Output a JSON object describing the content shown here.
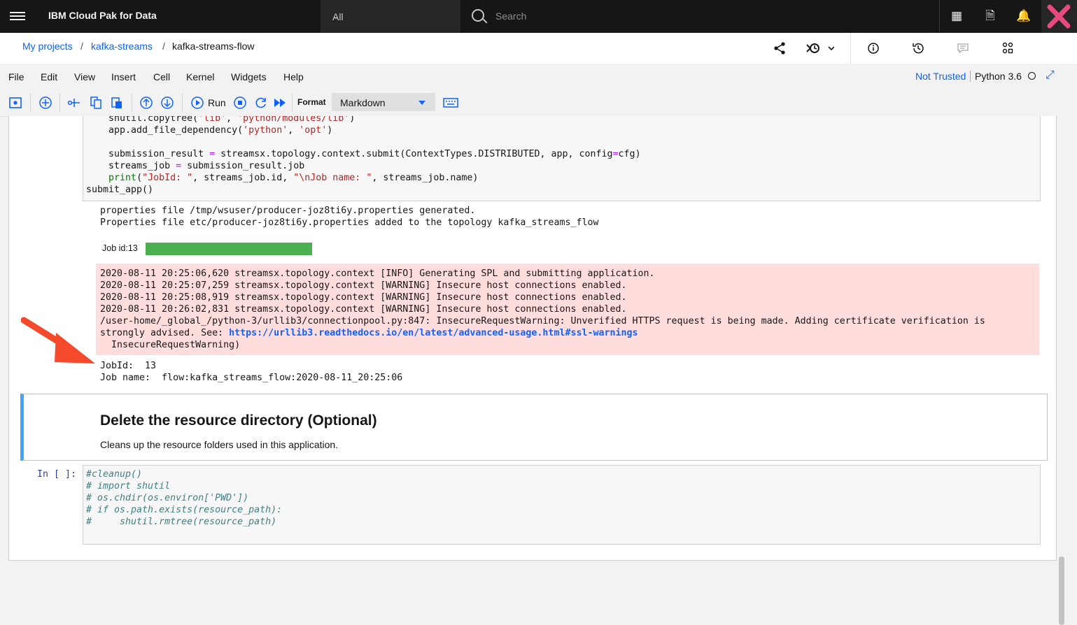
{
  "topbar": {
    "brand": "IBM Cloud Pak for Data",
    "scope": "All",
    "search_placeholder": "Search"
  },
  "breadcrumb": {
    "root": "My projects",
    "project": "kafka-streams",
    "current": "kafka-streams-flow"
  },
  "menu": [
    "File",
    "Edit",
    "View",
    "Insert",
    "Cell",
    "Kernel",
    "Widgets",
    "Help"
  ],
  "trust": "Not Trusted",
  "kernel": "Python 3.6",
  "toolbar": {
    "run_label": "Run",
    "format_label": "Format",
    "format_value": "Markdown"
  },
  "code_cell_1": {
    "lines": [
      "    shutil.copytree('lib', 'python/modules/lib')",
      "    app.add_file_dependency('python', 'opt')",
      "",
      "    submission_result = streamsx.topology.context.submit(ContextTypes.DISTRIBUTED, app, config=cfg)",
      "    streams_job = submission_result.job",
      "    print(\"JobId: \", streams_job.id, \"\\nJob name: \", streams_job.name)",
      "submit_app()"
    ]
  },
  "output": {
    "stdout": [
      "properties file /tmp/wsuser/producer-joz8ti6y.properties generated.",
      "Properties file etc/producer-joz8ti6y.properties added to the topology kafka_streams_flow"
    ],
    "job_label": "Job id:13",
    "job_progress": 1.0,
    "stderr": [
      "2020-08-11 20:25:06,620 streamsx.topology.context [INFO] Generating SPL and submitting application.",
      "2020-08-11 20:25:07,259 streamsx.topology.context [WARNING] Insecure host connections enabled.",
      "2020-08-11 20:25:08,919 streamsx.topology.context [WARNING] Insecure host connections enabled.",
      "2020-08-11 20:26:02,831 streamsx.topology.context [WARNING] Insecure host connections enabled.",
      "/user-home/_global_/python-3/urllib3/connectionpool.py:847: InsecureRequestWarning: Unverified HTTPS request is being made. Adding certificate verification is",
      "strongly advised. See: ",
      "  InsecureRequestWarning)"
    ],
    "stderr_link": "https://urllib3.readthedocs.io/en/latest/advanced-usage.html#ssl-warnings",
    "result": [
      "JobId:  13",
      "Job name:  flow:kafka_streams_flow:2020-08-11_20:25:06"
    ]
  },
  "markdown_cell": {
    "heading": "Delete the resource directory (Optional)",
    "text": "Cleans up the resource folders used in this application."
  },
  "code_cell_2": {
    "prompt": "In [ ]:",
    "lines": [
      "#cleanup()",
      "# import shutil",
      "# os.chdir(os.environ['PWD'])",
      "# if os.path.exists(resource_path):",
      "#     shutil.rmtree(resource_path)"
    ]
  },
  "colors": {
    "accent": "#0f62fe",
    "stderr_bg": "#ffdddd",
    "progress": "#4caf50",
    "md_border": "#42a5f5",
    "arrow": "#f44a2b"
  }
}
